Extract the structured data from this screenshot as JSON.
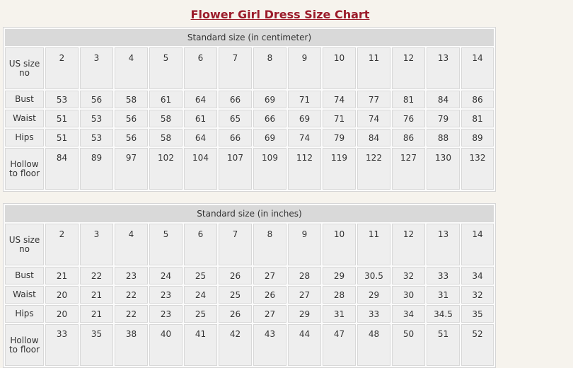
{
  "title": "Flower Girl Dress Size Chart",
  "tables": [
    {
      "caption": "Standard size (in centimeter)",
      "rows": [
        {
          "label": "US size no",
          "values": [
            "2",
            "3",
            "4",
            "5",
            "6",
            "7",
            "8",
            "9",
            "10",
            "11",
            "12",
            "13",
            "14"
          ]
        },
        {
          "label": "Bust",
          "values": [
            "53",
            "56",
            "58",
            "61",
            "64",
            "66",
            "69",
            "71",
            "74",
            "77",
            "81",
            "84",
            "86"
          ]
        },
        {
          "label": "Waist",
          "values": [
            "51",
            "53",
            "56",
            "58",
            "61",
            "65",
            "66",
            "69",
            "71",
            "74",
            "76",
            "79",
            "81"
          ]
        },
        {
          "label": "Hips",
          "values": [
            "51",
            "53",
            "56",
            "58",
            "64",
            "66",
            "69",
            "74",
            "79",
            "84",
            "86",
            "88",
            "89"
          ]
        },
        {
          "label": "Hollow to floor",
          "values": [
            "84",
            "89",
            "97",
            "102",
            "104",
            "107",
            "109",
            "112",
            "119",
            "122",
            "127",
            "130",
            "132"
          ]
        }
      ]
    },
    {
      "caption": "Standard size (in inches)",
      "rows": [
        {
          "label": "US size no",
          "values": [
            "2",
            "3",
            "4",
            "5",
            "6",
            "7",
            "8",
            "9",
            "10",
            "11",
            "12",
            "13",
            "14"
          ]
        },
        {
          "label": "Bust",
          "values": [
            "21",
            "22",
            "23",
            "24",
            "25",
            "26",
            "27",
            "28",
            "29",
            "30.5",
            "32",
            "33",
            "34"
          ]
        },
        {
          "label": "Waist",
          "values": [
            "20",
            "21",
            "22",
            "23",
            "24",
            "25",
            "26",
            "27",
            "28",
            "29",
            "30",
            "31",
            "32"
          ]
        },
        {
          "label": "Hips",
          "values": [
            "20",
            "21",
            "22",
            "23",
            "25",
            "26",
            "27",
            "29",
            "31",
            "33",
            "34",
            "34.5",
            "35"
          ]
        },
        {
          "label": "Hollow to floor",
          "values": [
            "33",
            "35",
            "38",
            "40",
            "41",
            "42",
            "43",
            "44",
            "47",
            "48",
            "50",
            "51",
            "52"
          ]
        }
      ]
    }
  ]
}
